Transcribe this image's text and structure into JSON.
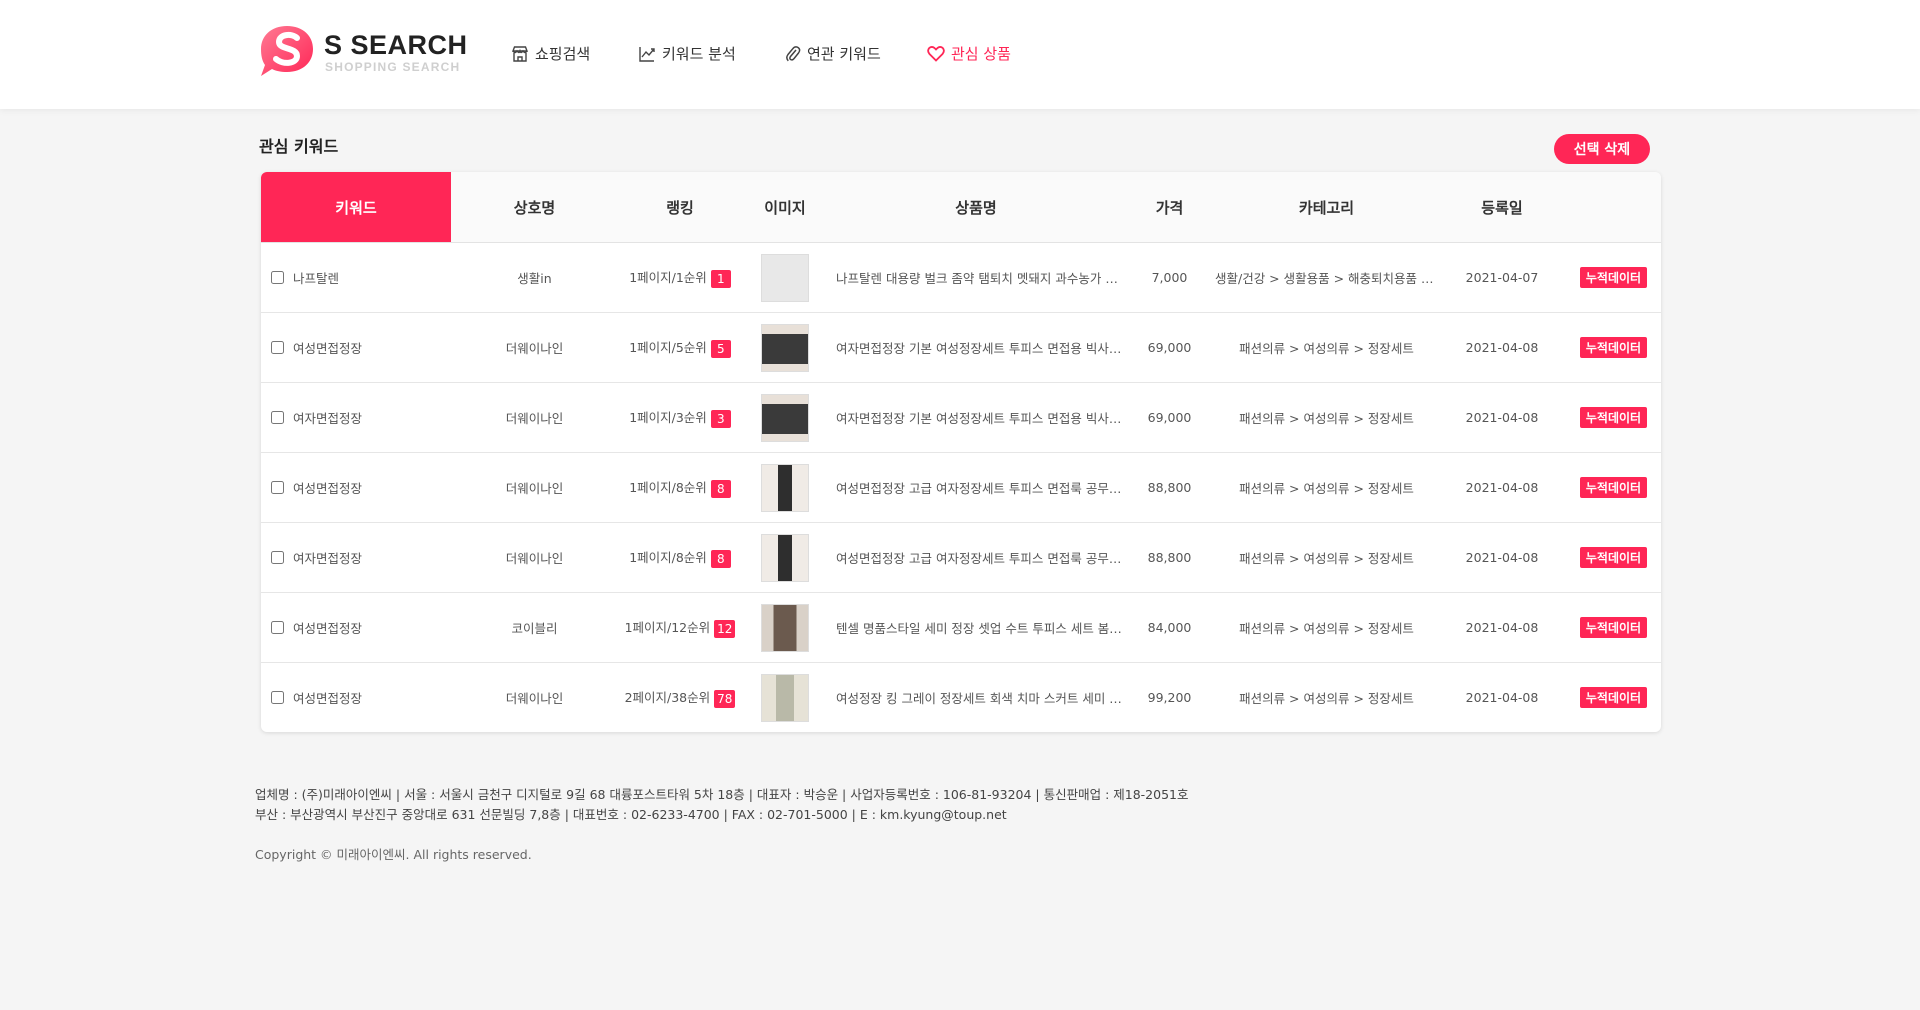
{
  "brand": {
    "title": "S SEARCH",
    "subtitle": "SHOPPING SEARCH"
  },
  "nav": [
    {
      "label": "쇼핑검색",
      "icon": "store-icon"
    },
    {
      "label": "키워드 분석",
      "icon": "line-chart-icon"
    },
    {
      "label": "연관 키워드",
      "icon": "paperclip-icon"
    },
    {
      "label": "관심 상품",
      "icon": "heart-icon"
    }
  ],
  "page": {
    "section_title": "관심 키워드",
    "delete_button": "선택 삭제"
  },
  "table": {
    "headers": [
      "키워드",
      "상호명",
      "랭킹",
      "이미지",
      "상품명",
      "가격",
      "카테고리",
      "등록일"
    ],
    "rows": [
      {
        "keyword": "나프탈렌",
        "store": "생활in",
        "rank": "1페이지/1순위",
        "rank_badge": "1",
        "thumb_color": "#e8e8e8",
        "product": "나프탈렌 대용량 벌크 좀약 탬퇴치 멧돼지 과수농가 방충...",
        "price": "7,000",
        "category": "생활/건강 > 생활용품 > 해충퇴치용품 > 방충제",
        "date": "2021-04-07",
        "badge": "누적데이터"
      },
      {
        "keyword": "여성면접정장",
        "store": "더웨이나인",
        "rank": "1페이지/5순위",
        "rank_badge": "5",
        "thumb_color": "#3a3a3a",
        "product": "여자면접정장 기본 여성정장세트 투피스 면접용 빅사이즈 ...",
        "price": "69,000",
        "category": "패션의류 > 여성의류 > 정장세트",
        "date": "2021-04-08",
        "badge": "누적데이터"
      },
      {
        "keyword": "여자면접정장",
        "store": "더웨이나인",
        "rank": "1페이지/3순위",
        "rank_badge": "3",
        "thumb_color": "#3a3a3a",
        "product": "여자면접정장 기본 여성정장세트 투피스 면접용 빅사이즈 ...",
        "price": "69,000",
        "category": "패션의류 > 여성의류 > 정장세트",
        "date": "2021-04-08",
        "badge": "누적데이터"
      },
      {
        "keyword": "여성면접정장",
        "store": "더웨이나인",
        "rank": "1페이지/8순위",
        "rank_badge": "8",
        "thumb_color": "#2e2e2e",
        "product": "여성면접정장 고급 여자정장세트 투피스 면접룩 공무원 빅...",
        "price": "88,800",
        "category": "패션의류 > 여성의류 > 정장세트",
        "date": "2021-04-08",
        "badge": "누적데이터"
      },
      {
        "keyword": "여자면접정장",
        "store": "더웨이나인",
        "rank": "1페이지/8순위",
        "rank_badge": "8",
        "thumb_color": "#2e2e2e",
        "product": "여성면접정장 고급 여자정장세트 투피스 면접룩 공무원 빅...",
        "price": "88,800",
        "category": "패션의류 > 여성의류 > 정장세트",
        "date": "2021-04-08",
        "badge": "누적데이터"
      },
      {
        "keyword": "여성면접정장",
        "store": "코이블리",
        "rank": "1페이지/12순위",
        "rank_badge": "12",
        "thumb_color": "#6b5a4e",
        "product": "텐셀 명품스타일 세미 정장 셋업 수트 투피스 세트 봄 ...",
        "price": "84,000",
        "category": "패션의류 > 여성의류 > 정장세트",
        "date": "2021-04-08",
        "badge": "누적데이터"
      },
      {
        "keyword": "여성면접정장",
        "store": "더웨이나인",
        "rank": "2페이지/38순위",
        "rank_badge": "78",
        "thumb_color": "#b9b9a8",
        "product": "여성정장 킹 그레이 정장세트 회색 치마 스커트 세미 여...",
        "price": "99,200",
        "category": "패션의류 > 여성의류 > 정장세트",
        "date": "2021-04-08",
        "badge": "누적데이터"
      }
    ]
  },
  "footer": {
    "line1": "업체명 : (주)미래아이엔씨 | 서울 : 서울시 금천구 디지털로 9길 68 대륭포스트타워 5차 18층 | 대표자 : 박승운 | 사업자등록번호 : 106-81-93204 | 통신판매업 : 제18-2051호",
    "line2": "부산 : 부산광역시 부산진구 중앙대로 631 선문빌딩 7,8층 | 대표번호 : 02-6233-4700 | FAX : 02-701-5000 | E : km.kyung@toup.net",
    "copyright": "Copyright © 미래아이엔씨. All rights reserved."
  },
  "colors": {
    "accent": "#ff2656"
  }
}
